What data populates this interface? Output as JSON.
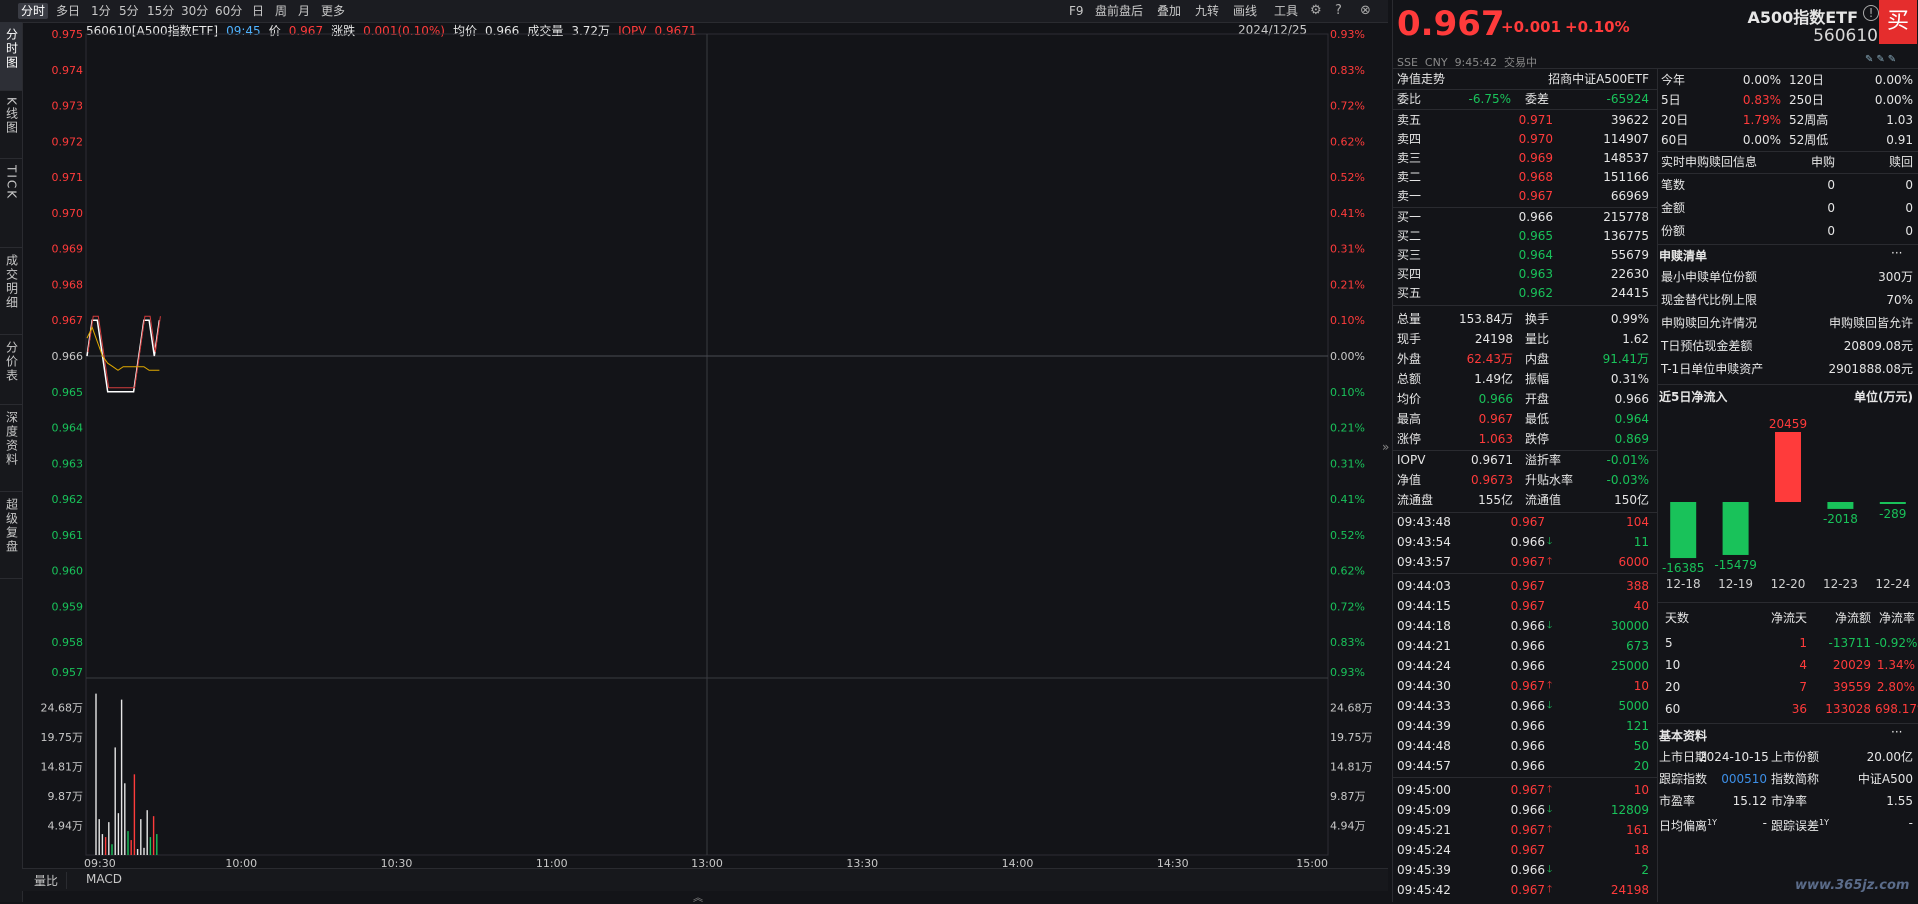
{
  "toolbar": {
    "left": [
      "分时",
      "多日",
      "1分",
      "5分",
      "15分",
      "30分",
      "60分",
      "日",
      "周",
      "月",
      "更多"
    ],
    "right": [
      "F9",
      "盘前盘后",
      "叠加",
      "九转",
      "画线",
      "工具"
    ]
  },
  "left_tabs": [
    "分时图",
    "K线图",
    "TICK",
    "成交明细",
    "分价表",
    "深度资料",
    "超级复盘"
  ],
  "chart_header": {
    "name": "560610[A500指数ETF]",
    "time": "09:45",
    "price_label": "价",
    "price": "0.967",
    "change_label": "涨跌",
    "change": "0.001(0.10%)",
    "avg_label": "均价",
    "avg": "0.966",
    "vol_label": "成交量",
    "vol": "3.72万",
    "iopv_label": "IOPV",
    "iopv": "0.9671",
    "date": "2024/12/25"
  },
  "chart_data": {
    "type": "line",
    "price_ticks": [
      "0.975",
      "0.974",
      "0.973",
      "0.972",
      "0.971",
      "0.970",
      "0.969",
      "0.968",
      "0.967",
      "0.966",
      "0.965",
      "0.964",
      "0.963",
      "0.962",
      "0.961",
      "0.960",
      "0.959",
      "0.958"
    ],
    "pct_ticks": [
      "0.93%",
      "0.83%",
      "0.72%",
      "0.62%",
      "0.52%",
      "0.41%",
      "0.31%",
      "0.21%",
      "0.10%",
      "0.00%",
      "0.10%",
      "0.21%",
      "0.31%",
      "0.41%",
      "0.52%",
      "0.62%",
      "0.72%",
      "0.83%"
    ],
    "vol_ticks_left": [
      "0.957",
      "24.68万",
      "19.75万",
      "14.81万",
      "9.87万",
      "4.94万"
    ],
    "vol_ticks_right": [
      "0.93%",
      "24.68万",
      "19.75万",
      "14.81万",
      "9.87万",
      "4.94万"
    ],
    "time_ticks": [
      "09:30",
      "10:00",
      "10:30",
      "11:00",
      "13:00",
      "13:30",
      "14:00",
      "14:30",
      "15:00"
    ],
    "ylim": [
      0.957,
      0.975
    ],
    "prev_close": 0.966,
    "price_series": [
      0.966,
      0.967,
      0.967,
      0.966,
      0.965,
      0.965,
      0.965,
      0.965,
      0.965,
      0.965,
      0.966,
      0.967,
      0.967,
      0.966,
      0.967
    ],
    "avg_series": [
      0.9665,
      0.9668,
      0.9664,
      0.966,
      0.9658,
      0.9657,
      0.9656,
      0.9657,
      0.9657,
      0.9657,
      0.9657,
      0.9657,
      0.9656,
      0.9656,
      0.9656
    ],
    "volume_series": [
      {
        "v": 270000,
        "c": "white"
      },
      {
        "v": 60000,
        "c": "white"
      },
      {
        "v": 35000,
        "c": "white"
      },
      {
        "v": 30000,
        "c": "red"
      },
      {
        "v": 55000,
        "c": "white"
      },
      {
        "v": 18000,
        "c": "green"
      },
      {
        "v": 180000,
        "c": "white"
      },
      {
        "v": 70000,
        "c": "white"
      },
      {
        "v": 260000,
        "c": "white"
      },
      {
        "v": 120000,
        "c": "white"
      },
      {
        "v": 40000,
        "c": "green"
      },
      {
        "v": 25000,
        "c": "red"
      },
      {
        "v": 135000,
        "c": "red"
      },
      {
        "v": 10000,
        "c": "white"
      },
      {
        "v": 60000,
        "c": "white"
      },
      {
        "v": 12000,
        "c": "white"
      },
      {
        "v": 75000,
        "c": "white"
      },
      {
        "v": 30000,
        "c": "green"
      },
      {
        "v": 65000,
        "c": "red"
      },
      {
        "v": 35000,
        "c": "green"
      }
    ],
    "vol_max": 296160
  },
  "bottom_tabs": [
    "量比",
    "MACD"
  ],
  "quote": {
    "price": "0.967",
    "change": "+0.001",
    "pct": "+0.10%",
    "name": "A500指数ETF",
    "code": "560610",
    "market": "SSE",
    "currency": "CNY",
    "time": "9:45:42",
    "status": "交易中",
    "buy_label": "买"
  },
  "nav": {
    "title": "净值走势",
    "fund": "招商中证A500ETF"
  },
  "order_ratio": {
    "label1": "委比",
    "v1": "-6.75%",
    "label2": "委差",
    "v2": "-65924"
  },
  "asks": [
    {
      "label": "卖五",
      "price": "0.971",
      "vol": "39622"
    },
    {
      "label": "卖四",
      "price": "0.970",
      "vol": "114907"
    },
    {
      "label": "卖三",
      "price": "0.969",
      "vol": "148537"
    },
    {
      "label": "卖二",
      "price": "0.968",
      "vol": "151166"
    },
    {
      "label": "卖一",
      "price": "0.967",
      "vol": "66969"
    }
  ],
  "bids": [
    {
      "label": "买一",
      "price": "0.966",
      "vol": "215778"
    },
    {
      "label": "买二",
      "price": "0.965",
      "vol": "136775"
    },
    {
      "label": "买三",
      "price": "0.964",
      "vol": "55679"
    },
    {
      "label": "买四",
      "price": "0.963",
      "vol": "22630"
    },
    {
      "label": "买五",
      "price": "0.962",
      "vol": "24415"
    }
  ],
  "stats": [
    {
      "l1": "总量",
      "v1": "153.84万",
      "c1": "white",
      "l2": "换手",
      "v2": "0.99%",
      "c2": "white"
    },
    {
      "l1": "现手",
      "v1": "24198",
      "c1": "white",
      "l2": "量比",
      "v2": "1.62",
      "c2": "white"
    },
    {
      "l1": "外盘",
      "v1": "62.43万",
      "c1": "red",
      "l2": "内盘",
      "v2": "91.41万",
      "c2": "green"
    },
    {
      "l1": "总额",
      "v1": "1.49亿",
      "c1": "white",
      "l2": "振幅",
      "v2": "0.31%",
      "c2": "white"
    },
    {
      "l1": "均价",
      "v1": "0.966",
      "c1": "green",
      "l2": "开盘",
      "v2": "0.966",
      "c2": "white"
    },
    {
      "l1": "最高",
      "v1": "0.967",
      "c1": "red",
      "l2": "最低",
      "v2": "0.964",
      "c2": "green"
    },
    {
      "l1": "涨停",
      "v1": "1.063",
      "c1": "red",
      "l2": "跌停",
      "v2": "0.869",
      "c2": "green"
    }
  ],
  "stats2": [
    {
      "l1": "IOPV",
      "v1": "0.9671",
      "c1": "white",
      "l2": "溢折率",
      "v2": "-0.01%",
      "c2": "green"
    },
    {
      "l1": "净值",
      "v1": "0.9673",
      "c1": "red",
      "l2": "升贴水率",
      "v2": "-0.03%",
      "c2": "green"
    },
    {
      "l1": "流通盘",
      "v1": "155亿",
      "c1": "white",
      "l2": "流通值",
      "v2": "150亿",
      "c2": "white"
    }
  ],
  "ticks": [
    {
      "t": "09:43:48",
      "p": "0.967",
      "pc": "red",
      "a": "",
      "v": "104",
      "vc": "red"
    },
    {
      "t": "09:43:54",
      "p": "0.966",
      "pc": "white",
      "a": "down",
      "v": "11",
      "vc": "green"
    },
    {
      "t": "09:43:57",
      "p": "0.967",
      "pc": "red",
      "a": "up",
      "v": "6000",
      "vc": "red"
    },
    {
      "t": "09:44:03",
      "p": "0.967",
      "pc": "red",
      "a": "",
      "v": "388",
      "vc": "red"
    },
    {
      "t": "09:44:15",
      "p": "0.967",
      "pc": "red",
      "a": "",
      "v": "40",
      "vc": "red"
    },
    {
      "t": "09:44:18",
      "p": "0.966",
      "pc": "white",
      "a": "down",
      "v": "30000",
      "vc": "green"
    },
    {
      "t": "09:44:21",
      "p": "0.966",
      "pc": "white",
      "a": "",
      "v": "673",
      "vc": "green"
    },
    {
      "t": "09:44:24",
      "p": "0.966",
      "pc": "white",
      "a": "",
      "v": "25000",
      "vc": "green"
    },
    {
      "t": "09:44:30",
      "p": "0.967",
      "pc": "red",
      "a": "up",
      "v": "10",
      "vc": "red"
    },
    {
      "t": "09:44:33",
      "p": "0.966",
      "pc": "white",
      "a": "down",
      "v": "5000",
      "vc": "green"
    },
    {
      "t": "09:44:39",
      "p": "0.966",
      "pc": "white",
      "a": "",
      "v": "121",
      "vc": "green"
    },
    {
      "t": "09:44:48",
      "p": "0.966",
      "pc": "white",
      "a": "",
      "v": "50",
      "vc": "green"
    },
    {
      "t": "09:44:57",
      "p": "0.966",
      "pc": "white",
      "a": "",
      "v": "20",
      "vc": "green"
    },
    {
      "t": "09:45:00",
      "p": "0.967",
      "pc": "red",
      "a": "up",
      "v": "10",
      "vc": "red"
    },
    {
      "t": "09:45:09",
      "p": "0.966",
      "pc": "white",
      "a": "down",
      "v": "12809",
      "vc": "green"
    },
    {
      "t": "09:45:21",
      "p": "0.967",
      "pc": "red",
      "a": "up",
      "v": "161",
      "vc": "red"
    },
    {
      "t": "09:45:24",
      "p": "0.967",
      "pc": "red",
      "a": "",
      "v": "18",
      "vc": "red"
    },
    {
      "t": "09:45:39",
      "p": "0.966",
      "pc": "white",
      "a": "down",
      "v": "2",
      "vc": "green"
    },
    {
      "t": "09:45:42",
      "p": "0.967",
      "pc": "red",
      "a": "up",
      "v": "24198",
      "vc": "red"
    }
  ],
  "perf": [
    {
      "l1": "今年",
      "v1": "0.00%",
      "c1": "white",
      "l2": "120日",
      "v2": "0.00%",
      "c2": "white"
    },
    {
      "l1": "5日",
      "v1": "0.83%",
      "c1": "red",
      "l2": "250日",
      "v2": "0.00%",
      "c2": "white"
    },
    {
      "l1": "20日",
      "v1": "1.79%",
      "c1": "red",
      "l2": "52周高",
      "v2": "1.03",
      "c2": "white"
    },
    {
      "l1": "60日",
      "v1": "0.00%",
      "c1": "white",
      "l2": "52周低",
      "v2": "0.91",
      "c2": "white"
    }
  ],
  "subscription": {
    "title": "实时申购赎回信息",
    "col1": "申购",
    "col2": "赎回",
    "rows": [
      {
        "label": "笔数",
        "a": "0",
        "b": "0"
      },
      {
        "label": "金额",
        "a": "0",
        "b": "0"
      },
      {
        "label": "份额",
        "a": "0",
        "b": "0"
      }
    ]
  },
  "creation": {
    "title": "申赎清单",
    "more": "···",
    "rows": [
      {
        "label": "最小申赎单位份额",
        "value": "300万"
      },
      {
        "label": "现金替代比例上限",
        "value": "70%"
      },
      {
        "label": "申购赎回允许情况",
        "value": "申购赎回皆允许"
      },
      {
        "label": "T日预估现金差额",
        "value": "20809.08元"
      },
      {
        "label": "T-1日单位申赎资产",
        "value": "2901888.08元"
      }
    ]
  },
  "inflow": {
    "title": "近5日净流入",
    "unit": "单位(万元)",
    "chart_data": {
      "type": "bar",
      "categories": [
        "12-18",
        "12-19",
        "12-20",
        "12-23",
        "12-24"
      ],
      "values": [
        -16385,
        -15479,
        20459,
        -2018,
        -289
      ]
    }
  },
  "flowtable": {
    "headers": [
      "天数",
      "净流天",
      "净流额",
      "净流率"
    ],
    "rows": [
      {
        "d": "5",
        "n": "1",
        "amt": "-13711",
        "amtc": "green",
        "r": "-0.92%",
        "rc": "green"
      },
      {
        "d": "10",
        "n": "4",
        "amt": "20029",
        "amtc": "red",
        "r": "1.34%",
        "rc": "red"
      },
      {
        "d": "20",
        "n": "7",
        "amt": "39559",
        "amtc": "red",
        "r": "2.80%",
        "rc": "red"
      },
      {
        "d": "60",
        "n": "36",
        "amt": "133028",
        "amtc": "red",
        "r": "698.17%",
        "rc": "red"
      }
    ]
  },
  "basic": {
    "title": "基本资料",
    "more": "···",
    "rows": [
      {
        "l1": "上市日期",
        "v1": "2024-10-15",
        "c1": "white",
        "l2": "上市份额",
        "v2": "20.00亿",
        "c2": "white"
      },
      {
        "l1": "跟踪指数",
        "v1": "000510",
        "c1": "blue",
        "l2": "指数简称",
        "v2": "中证A500",
        "c2": "white"
      },
      {
        "l1": "市盈率",
        "v1": "15.12",
        "c1": "white",
        "l2": "市净率",
        "v2": "1.55",
        "c2": "white"
      },
      {
        "l1": "日均偏离",
        "sup1": "1Y",
        "v1": "-",
        "c1": "white",
        "l2": "跟踪误差",
        "sup2": "1Y",
        "v2": "-",
        "c2": "white"
      }
    ]
  },
  "watermark": "www.365jz.com",
  "colors": {
    "up": "#ff3b3b",
    "down": "#19c25a",
    "price_line": "#ffffff",
    "avg_line": "#e0a800",
    "blue": "#3d8fe6"
  }
}
